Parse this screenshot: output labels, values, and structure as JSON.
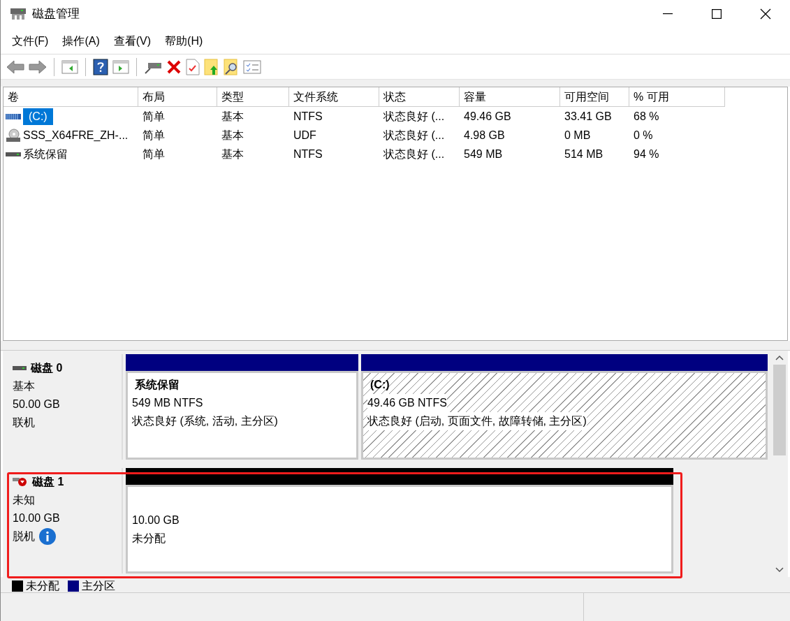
{
  "window": {
    "title": "磁盘管理"
  },
  "menu": [
    "文件(F)",
    "操作(A)",
    "查看(V)",
    "帮助(H)"
  ],
  "volume_table": {
    "columns": [
      "卷",
      "布局",
      "类型",
      "文件系统",
      "状态",
      "容量",
      "可用空间",
      "% 可用"
    ],
    "rows": [
      {
        "kind": "striped",
        "selected": true,
        "cells": [
          "(C:)",
          "简单",
          "基本",
          "NTFS",
          "状态良好 (...",
          "49.46 GB",
          "33.41 GB",
          "68 %"
        ]
      },
      {
        "kind": "optical",
        "selected": false,
        "cells": [
          "SSS_X64FRE_ZH-...",
          "简单",
          "基本",
          "UDF",
          "状态良好 (...",
          "4.98 GB",
          "0 MB",
          "0 %"
        ]
      },
      {
        "kind": "drive",
        "selected": false,
        "cells": [
          "系统保留",
          "简单",
          "基本",
          "NTFS",
          "状态良好 (...",
          "549 MB",
          "514 MB",
          "94 %"
        ]
      }
    ]
  },
  "disks": [
    {
      "name": "磁盘 0",
      "online": true,
      "type": "基本",
      "size": "50.00 GB",
      "status": "联机",
      "info": false,
      "partitions": [
        {
          "kind": "primary",
          "selected": false,
          "title": "系统保留",
          "size": "549 MB NTFS",
          "status": "状态良好 (系统, 活动, 主分区)"
        },
        {
          "kind": "primary",
          "selected": true,
          "title": "(C:)",
          "size": "49.46 GB NTFS",
          "status": "状态良好 (启动, 页面文件, 故障转储, 主分区)"
        }
      ]
    },
    {
      "name": "磁盘 1",
      "online": false,
      "type": "未知",
      "size": "10.00 GB",
      "status": "脱机",
      "info": true,
      "partitions": [
        {
          "kind": "unallocated",
          "selected": false,
          "size": "10.00 GB",
          "status": "未分配"
        }
      ]
    }
  ],
  "legend": [
    {
      "label": "未分配",
      "color": "#000000"
    },
    {
      "label": "主分区",
      "color": "#000080"
    }
  ],
  "highlight": true
}
